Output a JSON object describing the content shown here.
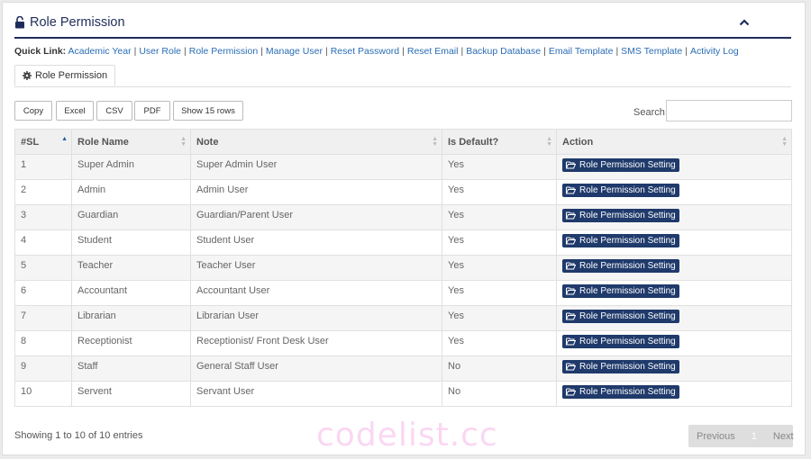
{
  "header": {
    "title": "Role Permission"
  },
  "quick_link": {
    "label": "Quick Link:",
    "links": [
      "Academic Year",
      "User Role",
      "Role Permission",
      "Manage User",
      "Reset Password",
      "Reset Email",
      "Backup Database",
      "Email Template",
      "SMS Template",
      "Activity Log"
    ]
  },
  "tab": {
    "label": "Role Permission"
  },
  "toolbar": {
    "copy": "Copy",
    "excel": "Excel",
    "csv": "CSV",
    "pdf": "PDF",
    "show_rows": "Show 15 rows"
  },
  "search": {
    "label": "Search:",
    "value": ""
  },
  "table": {
    "columns": [
      "#SL",
      "Role Name",
      "Note",
      "Is Default?",
      "Action"
    ],
    "action_label": "Role Permission Setting",
    "rows": [
      [
        "1",
        "Super Admin",
        "Super Admin User",
        "Yes"
      ],
      [
        "2",
        "Admin",
        "Admin User",
        "Yes"
      ],
      [
        "3",
        "Guardian",
        "Guardian/Parent User",
        "Yes"
      ],
      [
        "4",
        "Student",
        "Student User",
        "Yes"
      ],
      [
        "5",
        "Teacher",
        "Teacher User",
        "Yes"
      ],
      [
        "6",
        "Accountant",
        "Accountant User",
        "Yes"
      ],
      [
        "7",
        "Librarian",
        "Librarian User",
        "Yes"
      ],
      [
        "8",
        "Receptionist",
        "Receptionist/ Front Desk User",
        "Yes"
      ],
      [
        "9",
        "Staff",
        "General Staff User",
        "No"
      ],
      [
        "10",
        "Servent",
        "Servant User",
        "No"
      ]
    ]
  },
  "footer": {
    "info": "Showing 1 to 10 of 10 entries",
    "prev": "Previous",
    "page": "1",
    "next": "Next"
  },
  "watermark": "codelist.cc",
  "colors": {
    "accent": "#1f2d5a",
    "button": "#1f3a6b",
    "link": "#2a6db5"
  }
}
